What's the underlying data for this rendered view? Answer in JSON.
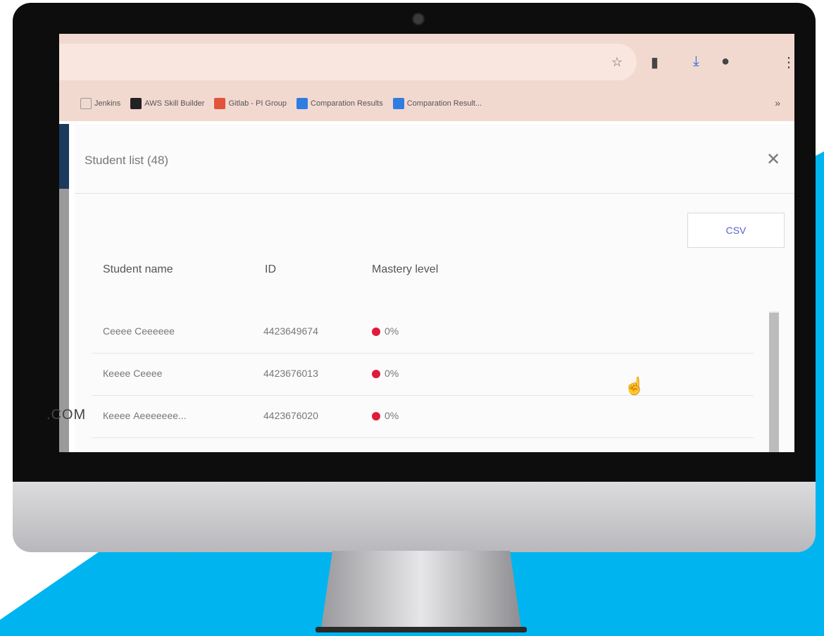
{
  "colors": {
    "accent_blue": "#00b4ef",
    "mastery_dot": "#e01b3c",
    "csv_text": "#5a64c8"
  },
  "browser": {
    "toolbar_icons": [
      "star-icon",
      "extension-icon",
      "download-icon",
      "profile-icon",
      "menu-icon"
    ],
    "bookmarks": [
      {
        "label": "Jenkins",
        "icon": "jenkins-icon"
      },
      {
        "label": "AWS Skill Builder",
        "icon": "aws-icon"
      },
      {
        "label": "Gitlab - PI Group",
        "icon": "gitlab-icon"
      },
      {
        "label": "Comparation Results",
        "icon": "doc-icon"
      },
      {
        "label": "Comparation Result...",
        "icon": "doc-icon"
      }
    ],
    "more_label": "»"
  },
  "dialog": {
    "title": "Student list (48)",
    "close_glyph": "✕",
    "csv_label": "CSV",
    "columns": {
      "name": "Student name",
      "id": "ID",
      "mastery": "Mastery level"
    },
    "rows": [
      {
        "name": "Сеееe Сееееее",
        "id": "4423649674",
        "mastery": "0%"
      },
      {
        "name": "Кееее Сееее",
        "id": "4423676013",
        "mastery": "0%"
      },
      {
        "name": "Кееее Аеееееее...",
        "id": "4423676020",
        "mastery": "0%"
      }
    ]
  },
  "watermark": ".COM"
}
